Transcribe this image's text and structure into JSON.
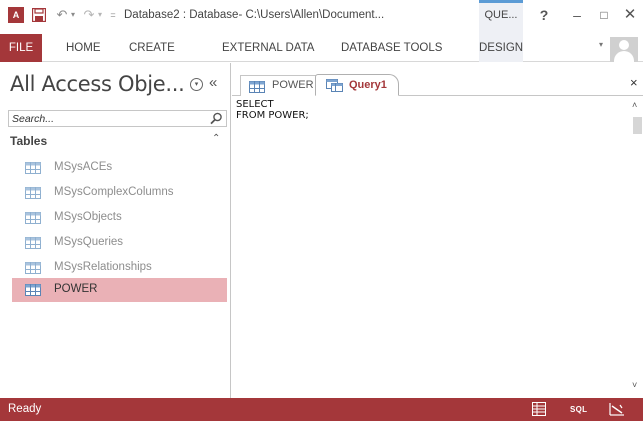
{
  "titlebar": {
    "app_icon_text": "A",
    "title": "Database2 : Database- C:\\Users\\Allen\\Document...",
    "context_tab_title": "QUE...",
    "help_label": "?",
    "minimize_label": "–",
    "maximize_label": "□",
    "close_label": "✕",
    "qat": {
      "undo_label": "↶",
      "redo_label": "↷",
      "dropdown_label": "▾",
      "customize_label": "="
    }
  },
  "ribbon": {
    "tabs": [
      {
        "label": "FILE"
      },
      {
        "label": "HOME"
      },
      {
        "label": "CREATE"
      },
      {
        "label": "EXTERNAL DATA"
      },
      {
        "label": "DATABASE TOOLS"
      },
      {
        "label": "DESIGN"
      }
    ],
    "collapse_label": "▾"
  },
  "nav": {
    "title": "All Access Obje...",
    "dropdown_label": "▾",
    "shutter_label": "«",
    "search_placeholder": "Search...",
    "group": {
      "label": "Tables",
      "collapse_label": "⌃"
    },
    "items": [
      {
        "label": "MSysACEs"
      },
      {
        "label": "MSysComplexColumns"
      },
      {
        "label": "MSysObjects"
      },
      {
        "label": "MSysQueries"
      },
      {
        "label": "MSysRelationships"
      },
      {
        "label": "POWER"
      }
    ],
    "selected_index": 5
  },
  "document": {
    "tabs": [
      {
        "label": "POWER"
      },
      {
        "label": "Query1"
      }
    ],
    "active_tab": "Query1",
    "close_label": "×",
    "sql_text": "SELECT\nFROM POWER;",
    "scroll": {
      "up_label": "˄",
      "down_label": "˅"
    }
  },
  "statusbar": {
    "text": "Ready",
    "sql_view_label": "SQL"
  },
  "colors": {
    "accent": "#a4373a",
    "selected_item": "#eab1b6",
    "context_tab": "#5b9bd5"
  },
  "icons": {
    "app": "access-icon",
    "save": "save-icon",
    "table": "table-icon",
    "query": "query-icon",
    "search": "search-icon",
    "avatar": "user-avatar"
  }
}
